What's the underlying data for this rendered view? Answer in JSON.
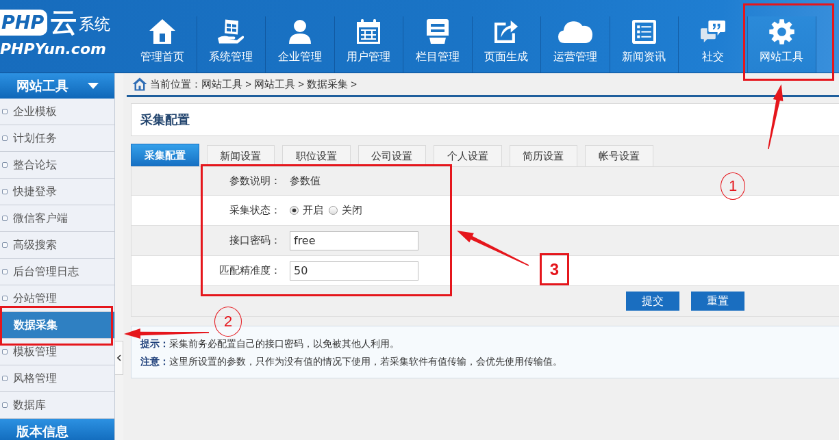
{
  "header": {
    "logo": {
      "mark": "PHP",
      "title": "云",
      "subtitle": "系统",
      "domain": "PHPYun.com"
    },
    "nav": [
      {
        "label": "管理首页",
        "selected": false
      },
      {
        "label": "系统管理",
        "selected": false
      },
      {
        "label": "企业管理",
        "selected": false
      },
      {
        "label": "用户管理",
        "selected": false
      },
      {
        "label": "栏目管理",
        "selected": false
      },
      {
        "label": "页面生成",
        "selected": false
      },
      {
        "label": "运营管理",
        "selected": false
      },
      {
        "label": "新闻资讯",
        "selected": false
      },
      {
        "label": "社交",
        "selected": false
      },
      {
        "label": "网站工具",
        "selected": true
      }
    ]
  },
  "sidebar": {
    "sections": [
      {
        "title": "网站工具",
        "expanded": true,
        "items": [
          {
            "label": "企业模板",
            "selected": false
          },
          {
            "label": "计划任务",
            "selected": false
          },
          {
            "label": "整合论坛",
            "selected": false
          },
          {
            "label": "快捷登录",
            "selected": false
          },
          {
            "label": "微信客户端",
            "selected": false
          },
          {
            "label": "高级搜索",
            "selected": false
          },
          {
            "label": "后台管理日志",
            "selected": false
          },
          {
            "label": "分站管理",
            "selected": false
          },
          {
            "label": "数据采集",
            "selected": true
          },
          {
            "label": "模板管理",
            "selected": false
          },
          {
            "label": "风格管理",
            "selected": false
          },
          {
            "label": "数据库",
            "selected": false
          }
        ]
      },
      {
        "title": "版本信息",
        "expanded": false
      }
    ]
  },
  "breadcrumb": "当前位置：网站工具 > 网站工具 > 数据采集 >",
  "panel": {
    "title": "采集配置",
    "tabs": [
      {
        "label": "采集配置",
        "selected": true
      },
      {
        "label": "新闻设置",
        "selected": false
      },
      {
        "label": "职位设置",
        "selected": false
      },
      {
        "label": "公司设置",
        "selected": false
      },
      {
        "label": "个人设置",
        "selected": false
      },
      {
        "label": "简历设置",
        "selected": false
      },
      {
        "label": "帐号设置",
        "selected": false
      }
    ],
    "form": {
      "rows": [
        {
          "kind": "header",
          "label": "参数说明：",
          "value": "参数值"
        },
        {
          "kind": "radio",
          "label": "采集状态：",
          "options": [
            {
              "label": "开启",
              "selected": true
            },
            {
              "label": "关闭",
              "selected": false
            }
          ]
        },
        {
          "kind": "input",
          "label": "接口密码：",
          "value": "free"
        },
        {
          "kind": "input",
          "label": "匹配精准度：",
          "value": "50"
        }
      ]
    },
    "buttons": [
      "提交",
      "重置"
    ]
  },
  "tips": [
    "**提示：**采集前务必配置自己的接口密码，以免被其他人利用。",
    "**注意：**这里所设置的参数，只作为没有值的情况下使用，若采集软件有值传输，会优先使用传输值。"
  ],
  "annotations": [
    {
      "kind": "circled",
      "label": "1"
    },
    {
      "kind": "boxed",
      "label": "3"
    },
    {
      "kind": "circled",
      "label": "2"
    }
  ]
}
